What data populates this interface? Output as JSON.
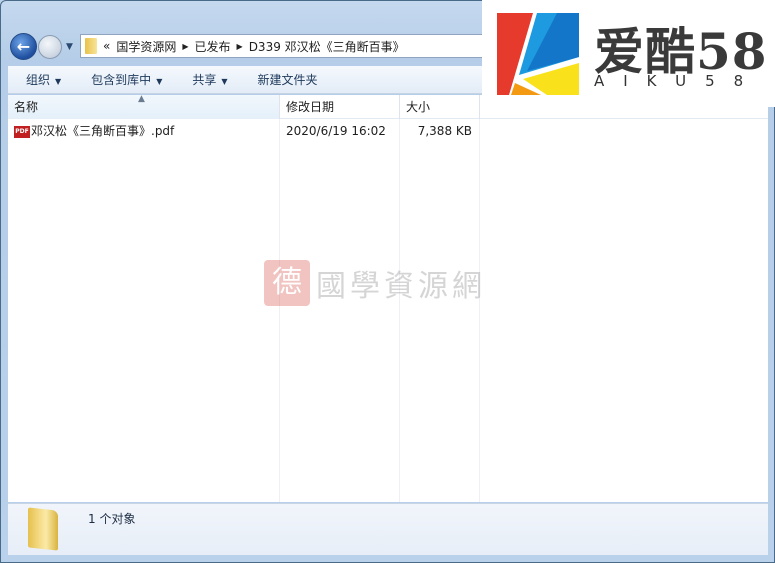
{
  "address": {
    "overflow": "«",
    "crumbs": [
      "国学资源网",
      "已发布",
      "D339 邓汉松《三角断百事》"
    ]
  },
  "toolbar": {
    "organize": "组织",
    "include": "包含到库中",
    "share": "共享",
    "new_folder": "新建文件夹"
  },
  "columns": {
    "name": "名称",
    "date": "修改日期",
    "size": "大小"
  },
  "files": [
    {
      "name": "邓汉松《三角断百事》.pdf",
      "date": "2020/6/19 16:02",
      "size": "7,388 KB",
      "icon": "pdf-icon"
    }
  ],
  "status": {
    "count": "1 个对象"
  },
  "watermark": {
    "text": "國學資源網"
  },
  "logo": {
    "cn": "爱酷58",
    "en": "AIKU58",
    "colors": [
      "#e53a2c",
      "#1e9be0",
      "#f9e21b",
      "#f39a12"
    ]
  }
}
